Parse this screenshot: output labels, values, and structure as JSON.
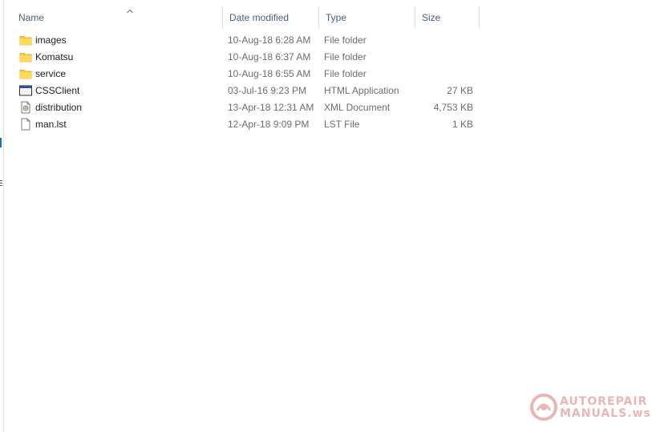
{
  "columns": {
    "name": "Name",
    "date_modified": "Date modified",
    "type": "Type",
    "size": "Size"
  },
  "sort": {
    "column": "name",
    "icon": "sort-ascending-icon"
  },
  "files": [
    {
      "name": "images",
      "date": "10-Aug-18 6:28 AM",
      "type": "File folder",
      "size": "",
      "icon": "folder-icon"
    },
    {
      "name": "Komatsu",
      "date": "10-Aug-18 6:37 AM",
      "type": "File folder",
      "size": "",
      "icon": "folder-icon"
    },
    {
      "name": "service",
      "date": "10-Aug-18 6:55 AM",
      "type": "File folder",
      "size": "",
      "icon": "folder-icon"
    },
    {
      "name": "CSSClient",
      "date": "03-Jul-16 9:23 PM",
      "type": "HTML Application",
      "size": "27 KB",
      "icon": "hta-application-icon"
    },
    {
      "name": "distribution",
      "date": "13-Apr-18 12:31 AM",
      "type": "XML Document",
      "size": "4,753 KB",
      "icon": "xml-document-icon"
    },
    {
      "name": "man.lst",
      "date": "12-Apr-18 9:09 PM",
      "type": "LST File",
      "size": "1 KB",
      "icon": "blank-file-icon"
    }
  ],
  "watermark": {
    "line1": "AUTOREPAIR",
    "line2": "MANUALS.ws",
    "color": "#e9b6b6"
  },
  "colors": {
    "header_text": "#4c607a",
    "folder": "#f5c842",
    "secondary_text": "#6d6d6d"
  }
}
